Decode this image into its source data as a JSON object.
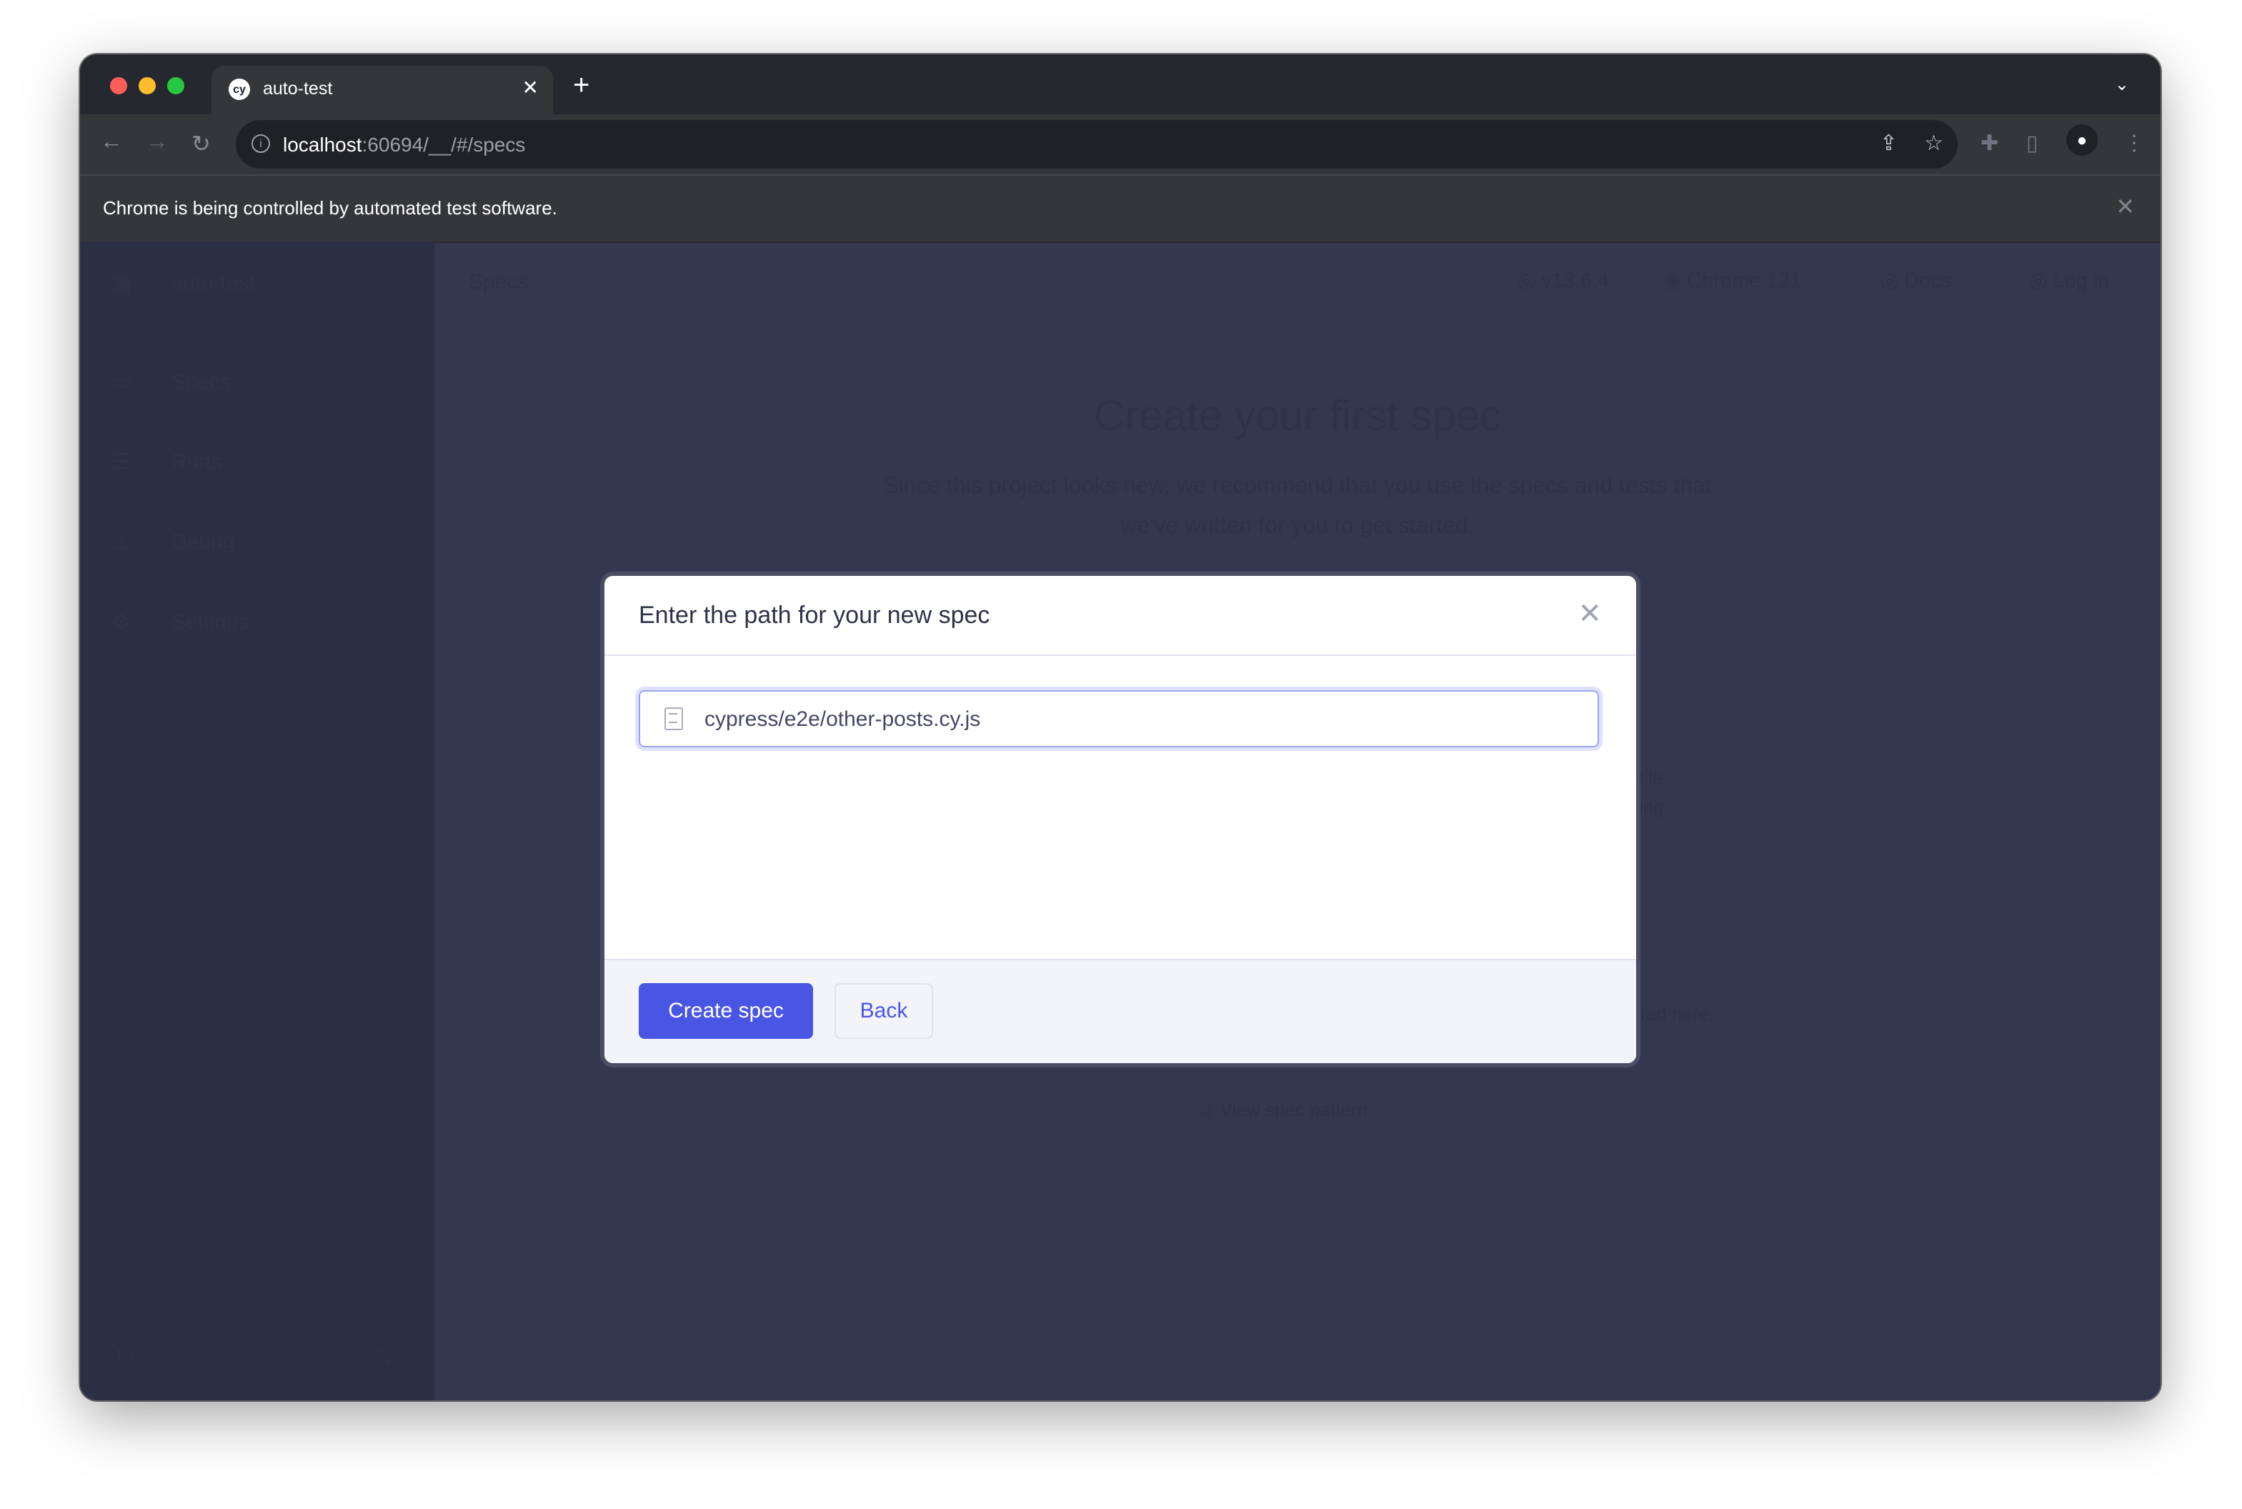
{
  "browser": {
    "tab_title": "auto-test",
    "tab_favicon": "cy",
    "url_host": "localhost",
    "url_rest": ":60694/__/#/specs",
    "infobar_message": "Chrome is being controlled by automated test software."
  },
  "sidebar": {
    "project": "auto-test",
    "items": [
      {
        "label": "Specs",
        "icon": "specs-icon"
      },
      {
        "label": "Runs",
        "icon": "runs-icon"
      },
      {
        "label": "Debug",
        "icon": "debug-icon"
      },
      {
        "label": "Settings",
        "icon": "gear-icon"
      }
    ]
  },
  "header": {
    "title": "Specs",
    "version": "v13.6.4",
    "browser": "Chrome 121",
    "docs": "Docs",
    "login": "Log in"
  },
  "main": {
    "heading": "Create your first spec",
    "description": "Since this project looks new, we recommend that you use the specs and tests that we've written for you to get started.",
    "card_fragment_1": "spec file",
    "card_fragment_2": "testing",
    "card_fragment_3": "listed here,",
    "view_spec_pattern": "View spec pattern"
  },
  "modal": {
    "title": "Enter the path for your new spec",
    "path_value": "cypress/e2e/other-posts.cy.js",
    "create_label": "Create spec",
    "back_label": "Back"
  },
  "colors": {
    "accent": "#4956e3",
    "overlay_bg": "#333850",
    "sidebar_bg": "#2b2f44"
  }
}
